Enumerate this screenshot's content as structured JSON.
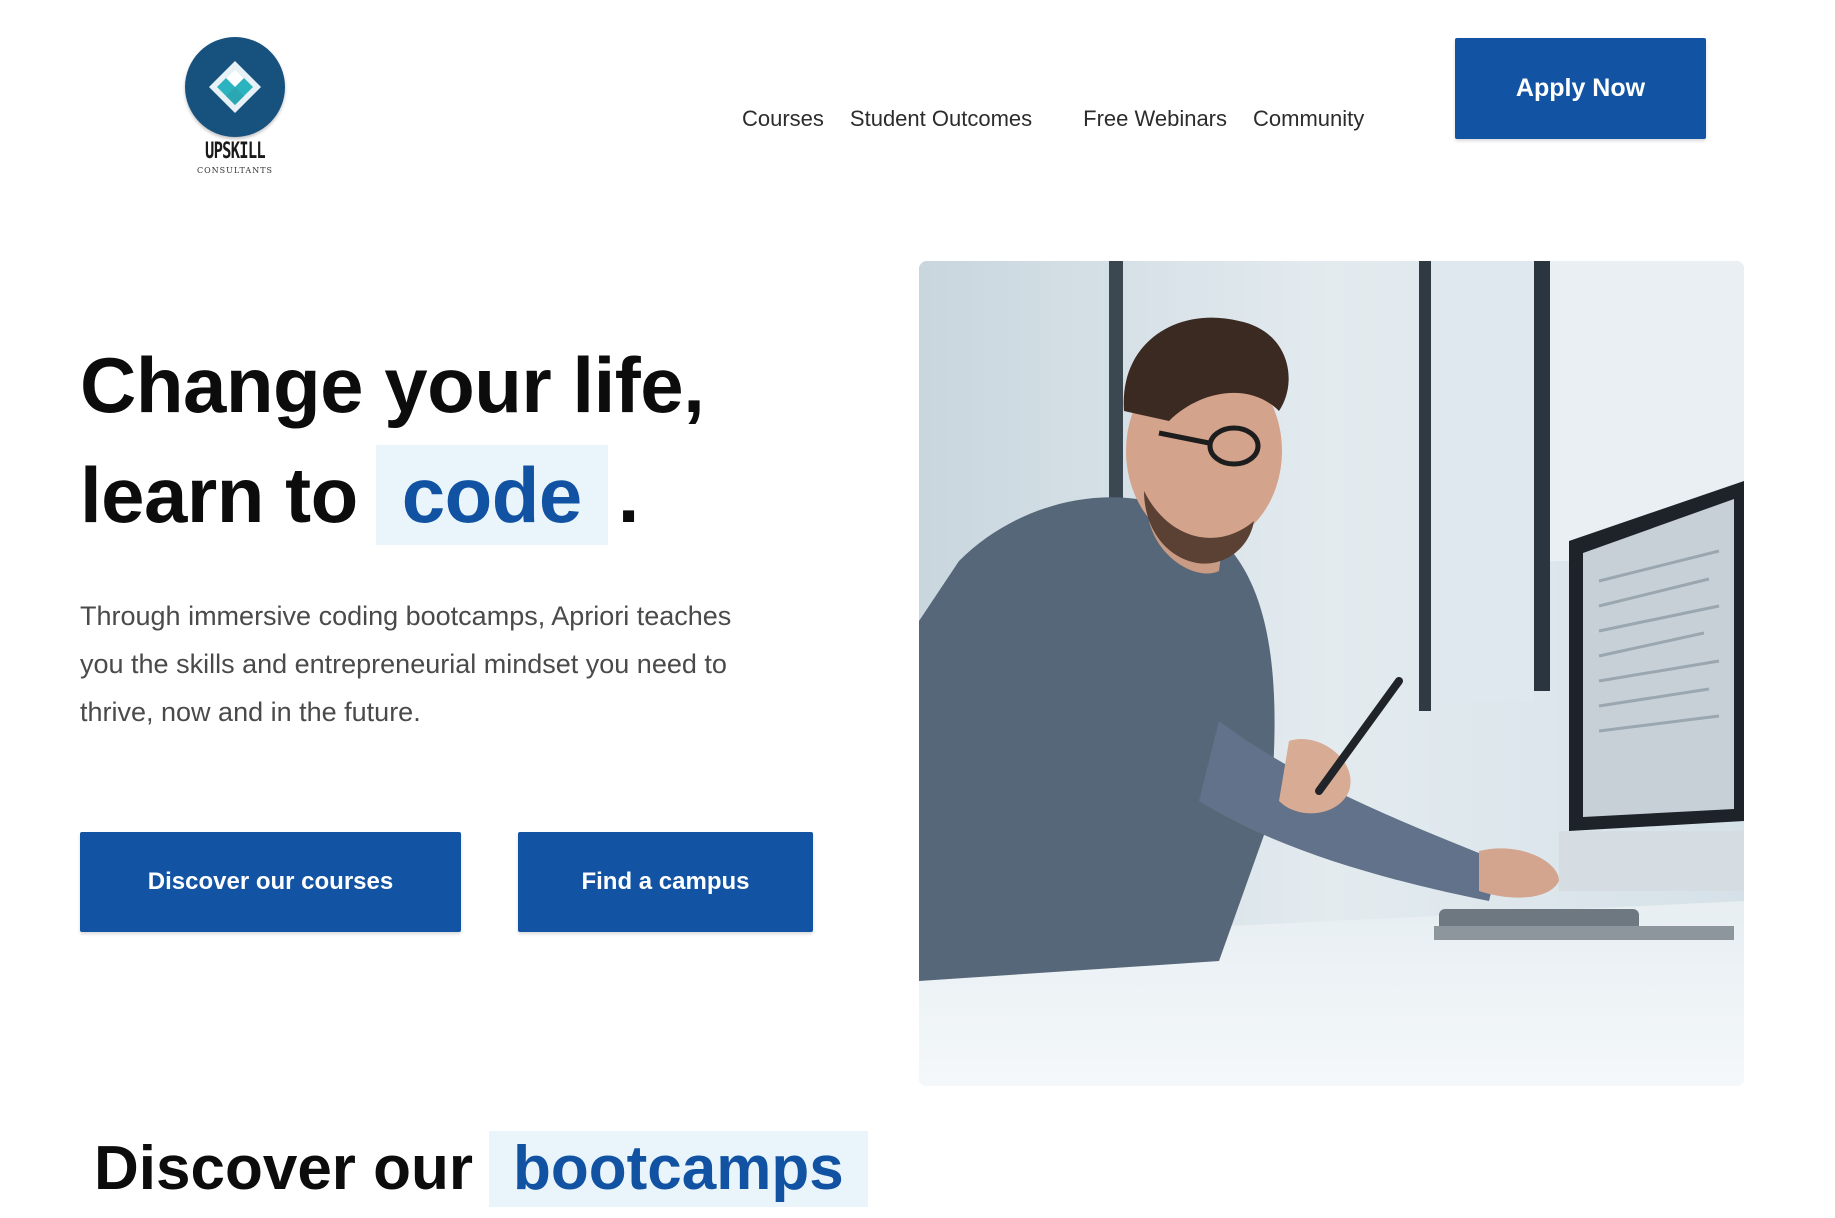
{
  "logo": {
    "name": "UPSKILL",
    "sub": "CONSULTANTS"
  },
  "nav": {
    "items": [
      "Courses",
      "Student Outcomes",
      "Free Webinars",
      "Community"
    ],
    "apply_label": "Apply Now"
  },
  "hero": {
    "title_line1": "Change your life,",
    "title_line2_prefix": "learn to",
    "title_highlight": "code",
    "title_suffix": ".",
    "description": "Through immersive coding bootcamps, Apriori teaches you the skills and entrepreneurial mindset you need to thrive, now and in the future.",
    "btn_courses": "Discover our courses",
    "btn_campus": "Find a campus"
  },
  "section": {
    "title_prefix": "Discover our",
    "title_highlight": "bootcamps"
  },
  "colors": {
    "primary": "#1353a3",
    "highlight_bg": "#e9f5fb",
    "text": "#0c0c0c"
  }
}
